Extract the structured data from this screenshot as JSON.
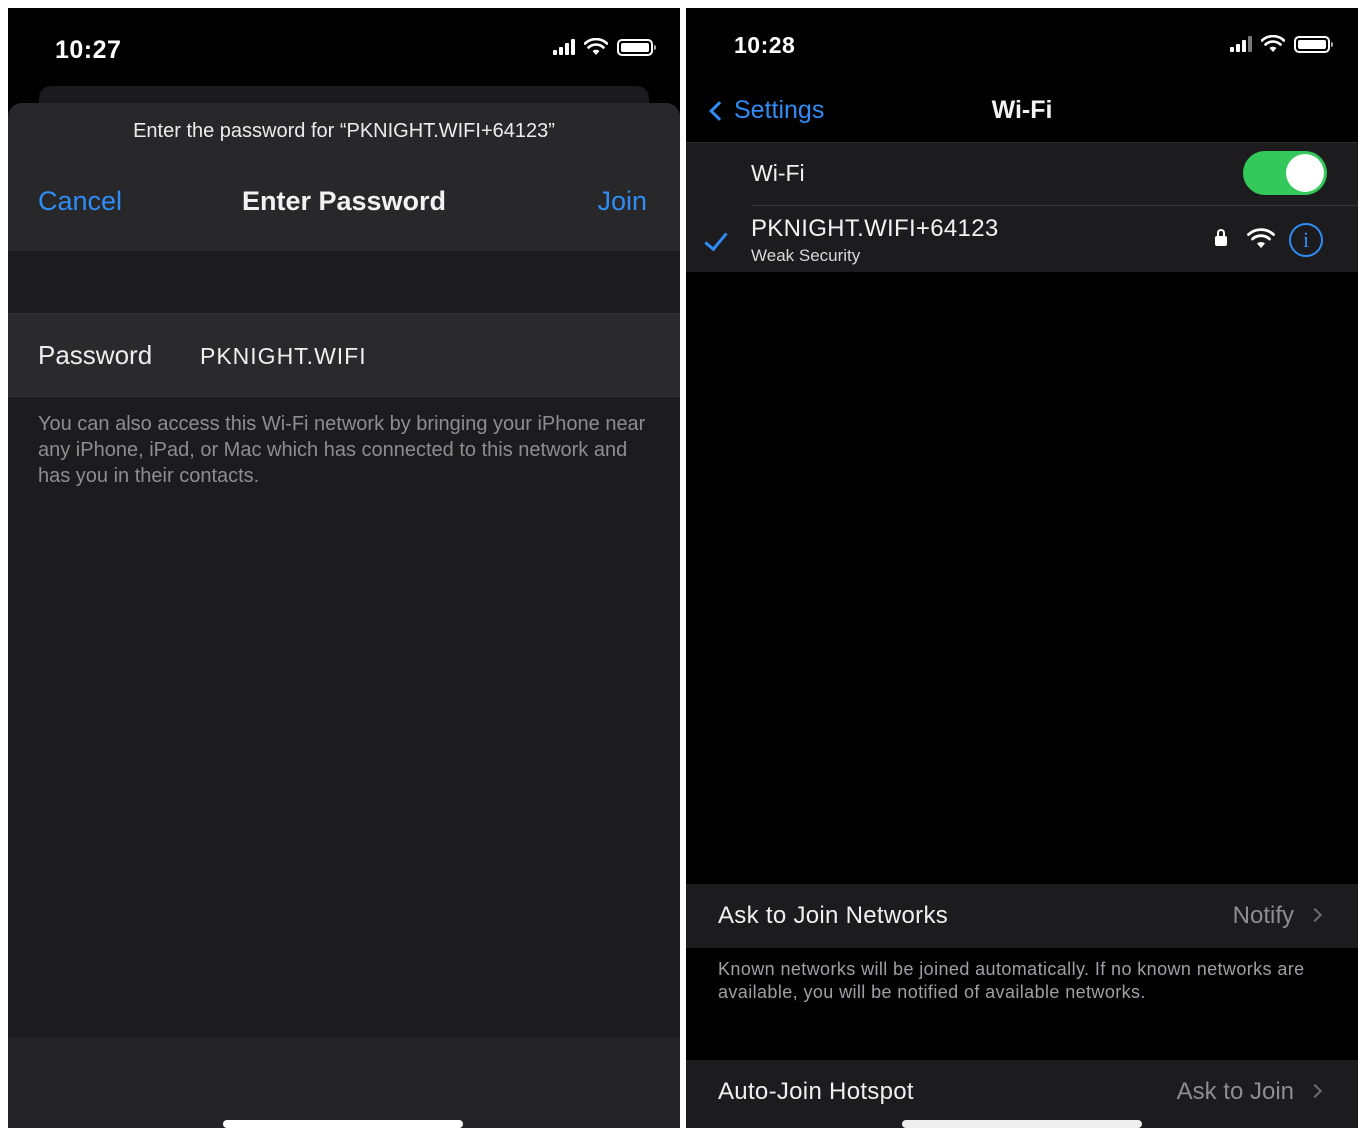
{
  "left_screen": {
    "status_bar": {
      "time": "10:27"
    },
    "sheet": {
      "prompt": "Enter the password for “PKNIGHT.WIFI+64123”",
      "cancel_label": "Cancel",
      "title": "Enter Password",
      "join_label": "Join",
      "password_label": "Password",
      "password_value": "PKNIGHT.WIFI",
      "footer_text": "You can also access this Wi-Fi network by bringing your iPhone near any iPhone, iPad, or Mac which has connected to this network and has you in their contacts."
    }
  },
  "right_screen": {
    "status_bar": {
      "time": "10:28"
    },
    "nav": {
      "back_label": "Settings",
      "title": "Wi-Fi"
    },
    "wifi_toggle": {
      "label": "Wi-Fi",
      "on": true,
      "accent": "#34c759"
    },
    "connected_network": {
      "name": "PKNIGHT.WIFI+64123",
      "subtitle": "Weak Security",
      "icons": [
        "check-icon",
        "lock-icon",
        "wifi-icon",
        "info-icon"
      ],
      "info_glyph": "i"
    },
    "ask_to_join": {
      "label": "Ask to Join Networks",
      "value": "Notify",
      "footer": "Known networks will be joined automatically. If no known networks are available, you will be notified of available networks."
    },
    "auto_join_hotspot": {
      "label": "Auto-Join Hotspot",
      "value": "Ask to Join"
    }
  },
  "colors": {
    "accent_blue": "#2f8cf5",
    "toggle_green": "#34c759",
    "background": "#000000",
    "cell": "#1c1c1e"
  }
}
